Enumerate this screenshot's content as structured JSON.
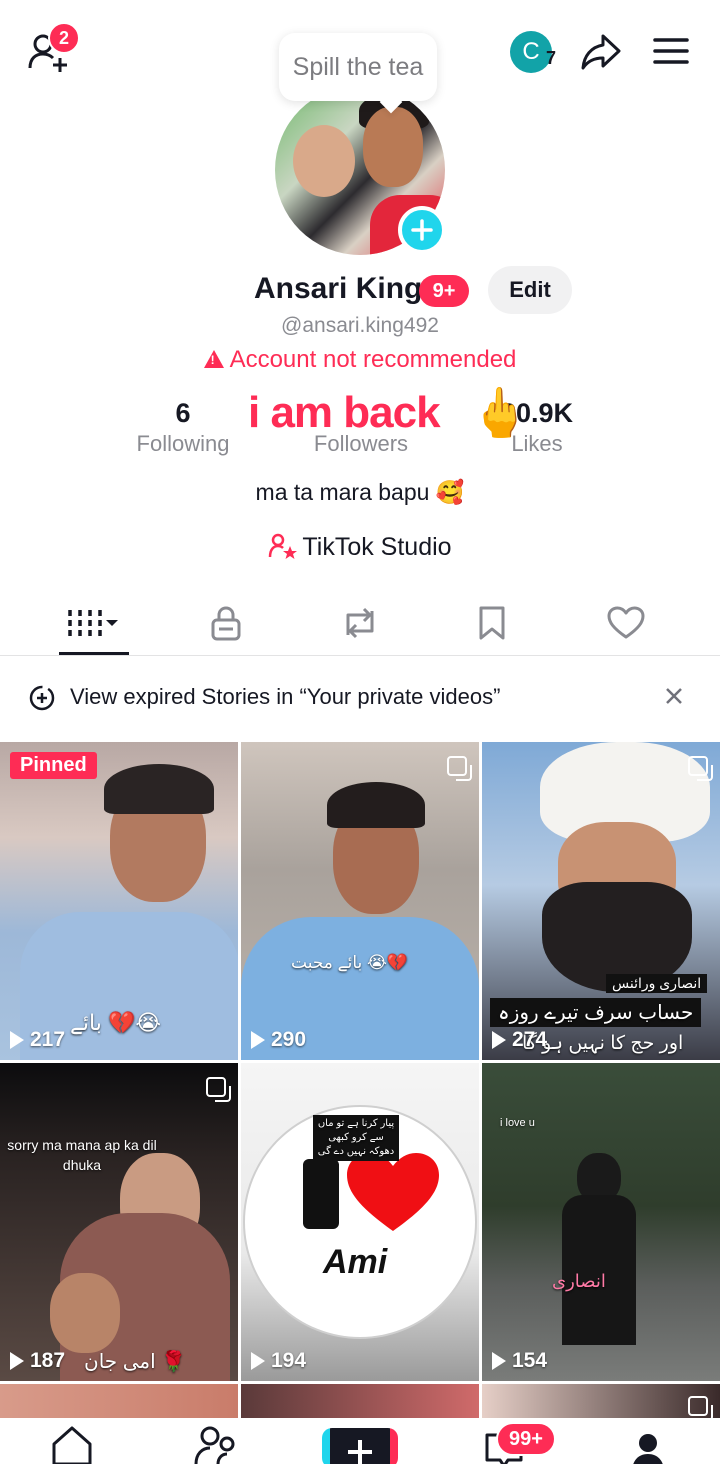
{
  "header": {
    "add_friends_badge": "2",
    "tooltip": "Spill the tea",
    "avatar_letter": "C",
    "avatar_count": "7"
  },
  "profile": {
    "name": "Ansari King",
    "name_badge": "9+",
    "edit_label": "Edit",
    "handle": "@ansari.king492",
    "warning": "Account not recommended",
    "bio": "ma ta mara bapu 🥰",
    "studio_label": "TikTok Studio",
    "overlay_text": "i am back",
    "overlay_emoji": "🖕"
  },
  "stats": {
    "following_count": "6",
    "following_label": "Following",
    "followers_label": "Followers",
    "likes_count": "20.9K",
    "likes_label": "Likes"
  },
  "tabs": [
    "videos",
    "private",
    "reposts",
    "favorites",
    "liked"
  ],
  "stories_bar": {
    "text": "View expired Stories in “Your private videos”"
  },
  "videos": [
    {
      "views": "217",
      "pinned_label": "Pinned",
      "caption": "بائے 💔😭"
    },
    {
      "views": "290",
      "caption": "بائے محبت 😭💔"
    },
    {
      "views": "274",
      "caption_top": "انصاری ورائنس",
      "caption_mid": "حساب سرف تیرے روزہ",
      "caption_bot": "اور حج کا نہیں ہو گا"
    },
    {
      "views": "187",
      "caption": "sorry ma mana ap ka dil dhuka",
      "caption_bottom": "امی جان 🌹"
    },
    {
      "views": "194",
      "caption": "Ami",
      "caption_top": "پیار کرنا ہے تو ماں سے کرو کبھی دھوکہ نہیں دے گی"
    },
    {
      "views": "154",
      "caption": "انصاری",
      "caption_top": "i love u"
    }
  ],
  "bottom_nav": {
    "inbox_badge": "99+"
  },
  "colors": {
    "accent": "#fe2c55",
    "cyan": "#20d5ec",
    "text": "#161823",
    "muted": "#8a8b91"
  }
}
